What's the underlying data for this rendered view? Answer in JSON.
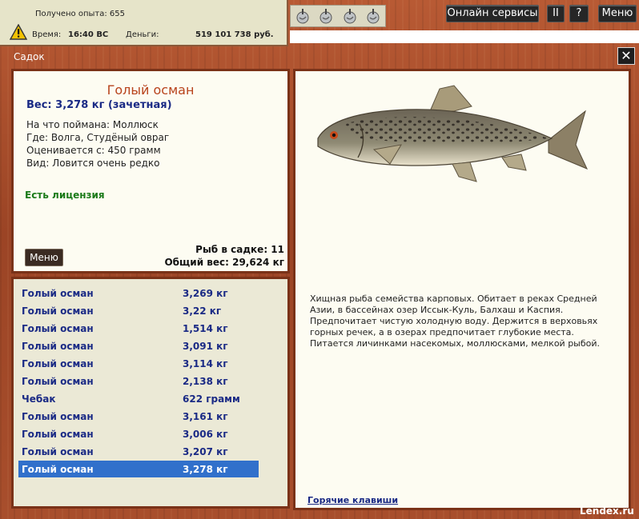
{
  "hud": {
    "xp_text": "Получено опыта: 655",
    "time_label": "Время:",
    "time_value": "16:40 ВС",
    "money_label": "Деньги:",
    "money_value": "519 101 738 руб."
  },
  "top_buttons": {
    "online": "Онлайн сервисы",
    "pause": "II",
    "help": "?",
    "menu": "Меню"
  },
  "window": {
    "title": "Садок",
    "close": "✕"
  },
  "fish": {
    "name": "Голый осман",
    "weight": "Вес: 3,278 кг (зачетная)",
    "bait": "На что поймана: Моллюск",
    "where": "Где: Волга, Студёный овраг",
    "evaluated": "Оценивается с: 450 грамм",
    "kind": "Вид: Ловится очень редко",
    "license": "Есть лицензия",
    "menu_button": "Меню",
    "cage_count": "Рыб в садке: 11",
    "total_weight": "Общий вес: 29,624 кг"
  },
  "catch_list": [
    {
      "name": "Голый осман",
      "weight": "3,269 кг"
    },
    {
      "name": "Голый осман",
      "weight": "3,22 кг"
    },
    {
      "name": "Голый осман",
      "weight": "1,514 кг"
    },
    {
      "name": "Голый осман",
      "weight": "3,091 кг"
    },
    {
      "name": "Голый осман",
      "weight": "3,114 кг"
    },
    {
      "name": "Голый осман",
      "weight": "2,138 кг"
    },
    {
      "name": "Чебак",
      "weight": "622 грамм"
    },
    {
      "name": "Голый осман",
      "weight": "3,161 кг"
    },
    {
      "name": "Голый осман",
      "weight": "3,006 кг"
    },
    {
      "name": "Голый осман",
      "weight": "3,207 кг"
    },
    {
      "name": "Голый осман",
      "weight": "3,278 кг"
    }
  ],
  "selected_index": 10,
  "description": {
    "text": "Хищная рыба семейства карповых. Обитает в реках Средней Азии, в бассейнах озер Иссык-Куль, Балхаш и Каспия. Предпочитает чистую холодную воду. Держится в верховьях горных речек, а в озерах предпочитает глубокие места. Питается личинками насекомых, моллюсками, мелкой рыбой.",
    "hotkeys": "Горячие клавиши"
  },
  "watermark": "Lendex.ru",
  "icons": {
    "warning": "warning-icon",
    "tools": [
      "hook-icon",
      "hook-icon",
      "hook-icon",
      "hook-icon"
    ]
  },
  "colors": {
    "selected_row": "#3170cb",
    "fish_name": "#b8431c",
    "list_text": "#1a2a85",
    "license": "#1a7a1a",
    "panel_border": "#7a3218"
  }
}
